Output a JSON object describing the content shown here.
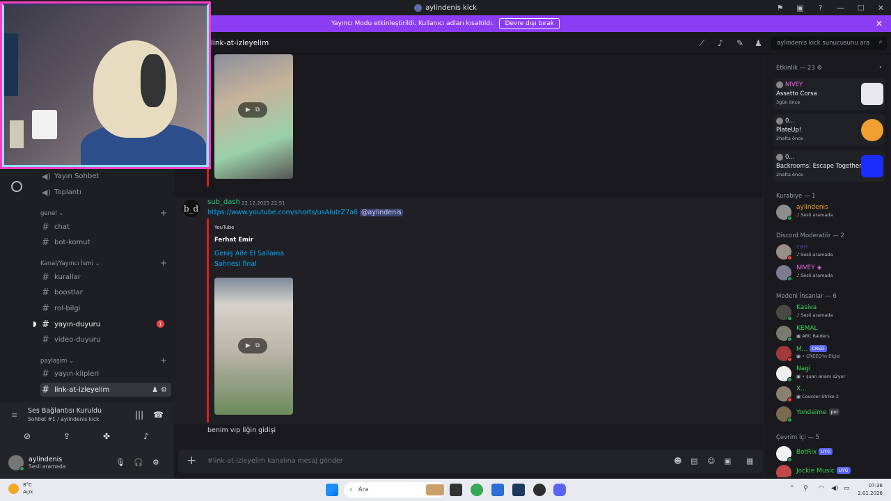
{
  "window": {
    "title": "aylindenis kick"
  },
  "banner": {
    "message": "Yayıncı Modu etkinleştirildi. Kullanıcı adları kısaltıldı.",
    "button": "Devre dışı bırak"
  },
  "sidebar": {
    "voice_channels": [
      {
        "label": "Yayın Sohbet"
      },
      {
        "label": "Toplantı"
      }
    ],
    "categories": [
      {
        "label": "genel"
      },
      {
        "label": "Kanal/Yayıncı İsmi"
      },
      {
        "label": "paylaşım"
      }
    ],
    "channels": [
      {
        "label": "chat"
      },
      {
        "label": "bot-komut"
      },
      {
        "label": "kurallar"
      },
      {
        "label": "boostlar"
      },
      {
        "label": "rol-bilgi"
      },
      {
        "label": "yayın-duyuru",
        "badge": "1"
      },
      {
        "label": "video-duyuru"
      },
      {
        "label": "yayın-klipleri"
      },
      {
        "label": "link-at-izleyelim"
      }
    ]
  },
  "voice_panel": {
    "status": "Ses Bağlantısı Kuruldu",
    "channel": "Sohbet #1 / aylindenis kick",
    "user_name": "aylindenis",
    "user_status": "Sesli aramada"
  },
  "chat": {
    "channel_name": "link-at-izleyelim",
    "search_placeholder": "aylindenis kick sunucusunu ara",
    "message": {
      "author": "sub_dash",
      "avatar_text": "b_d",
      "timestamp": "22.12.2025 22:51",
      "link": "https://www.youtube.com/shorts/usAIutrZ7a8",
      "mention": "@aylindenis",
      "embed_provider": "YouTube",
      "embed_author": "Ferhat Emir",
      "embed_title": "Geniş Aile El Sallama Sahnesi final"
    },
    "followup_text": "benim vıp liğin gidişi",
    "input_placeholder": "#link-at-izleyelim kanalına mesaj gönder"
  },
  "members": {
    "activity_header": "Etkinlik — 23",
    "activities": [
      {
        "user": "NIVEY",
        "game": "Assetto Corsa",
        "ago": "3gün önce",
        "user_color": "#e866e8",
        "art_color": "#e8e8ec"
      },
      {
        "user": "0...",
        "game": "PlateUp!",
        "ago": "2hafta önce",
        "user_color": "#dbdee1",
        "art_color": "#f0a030"
      },
      {
        "user": "0...",
        "game": "Backrooms: Escape Together",
        "ago": "2hafta önce",
        "user_color": "#dbdee1",
        "art_color": "#1b2cff"
      }
    ],
    "groups": [
      {
        "header": "Kurabiye — 1",
        "items": [
          {
            "name": "aylindenis",
            "sub": "Sesli aramada",
            "color": "#f0a030"
          }
        ]
      },
      {
        "header": "Discord Moderatör — 2",
        "items": [
          {
            "name": "can",
            "sub": "Sesli aramada",
            "color": "#4a3fb8"
          },
          {
            "name": "NIVEY",
            "sub": "Sesli aramada",
            "color": "#e866e8"
          }
        ]
      },
      {
        "header": "Medeni İnsanlar — 6",
        "items": [
          {
            "name": "Kasiva",
            "sub": "Sesli aramada",
            "color": "#3ad45a"
          },
          {
            "name": "KEMAL",
            "sub": "ARC Raiders",
            "color": "#3ad45a"
          },
          {
            "name": "M...",
            "sub": "CREED'in Elçisi",
            "color": "#3ad45a",
            "tag": "CRED"
          },
          {
            "name": "Nagi",
            "sub": "şuan anam s2yor",
            "color": "#3ad45a"
          },
          {
            "name": "X...",
            "sub": "Counter-Strike 2",
            "color": "#3ad45a"
          },
          {
            "name": "Yondaime",
            "sub": "",
            "color": "#3ad45a",
            "tag": "poi"
          }
        ]
      },
      {
        "header": "Çevrim İçi — 5",
        "items": [
          {
            "name": "BotRix",
            "sub": "",
            "color": "#3ad45a",
            "tag": "UYG"
          },
          {
            "name": "Jockie Music",
            "sub": "",
            "color": "#3ad45a",
            "tag": "UYG"
          }
        ]
      }
    ]
  },
  "taskbar": {
    "temperature": "8°C",
    "weather": "Açık",
    "search": "Ara",
    "time": "07:36",
    "date": "2.01.2026"
  }
}
